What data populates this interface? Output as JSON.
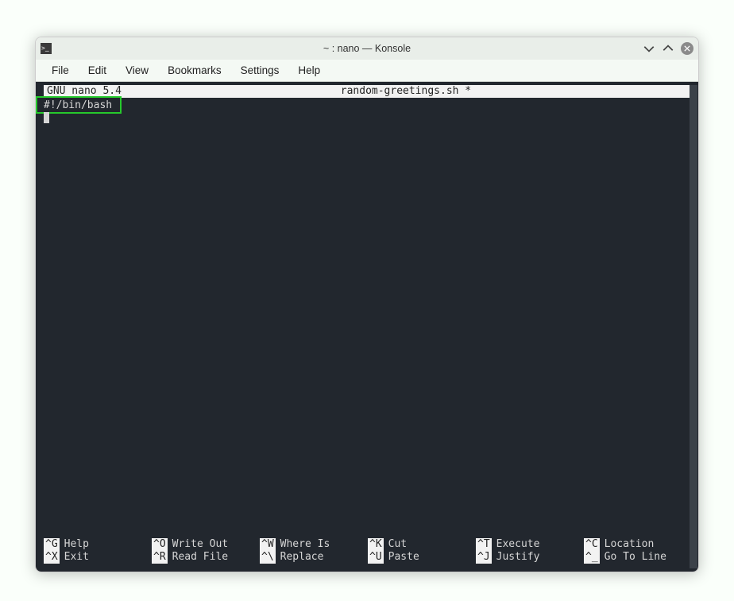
{
  "window": {
    "title": "~ : nano — Konsole"
  },
  "menubar": {
    "items": [
      "File",
      "Edit",
      "View",
      "Bookmarks",
      "Settings",
      "Help"
    ]
  },
  "nano": {
    "version": "GNU nano 5.4",
    "filename": "random-greetings.sh *",
    "line1": "#!/bin/bash",
    "shortcuts": [
      {
        "key": "^G",
        "label": "Help"
      },
      {
        "key": "^O",
        "label": "Write Out"
      },
      {
        "key": "^W",
        "label": "Where Is"
      },
      {
        "key": "^K",
        "label": "Cut"
      },
      {
        "key": "^T",
        "label": "Execute"
      },
      {
        "key": "^C",
        "label": "Location"
      },
      {
        "key": "^X",
        "label": "Exit"
      },
      {
        "key": "^R",
        "label": "Read File"
      },
      {
        "key": "^\\",
        "label": "Replace"
      },
      {
        "key": "^U",
        "label": "Paste"
      },
      {
        "key": "^J",
        "label": "Justify"
      },
      {
        "key": "^_",
        "label": "Go To Line"
      }
    ]
  }
}
